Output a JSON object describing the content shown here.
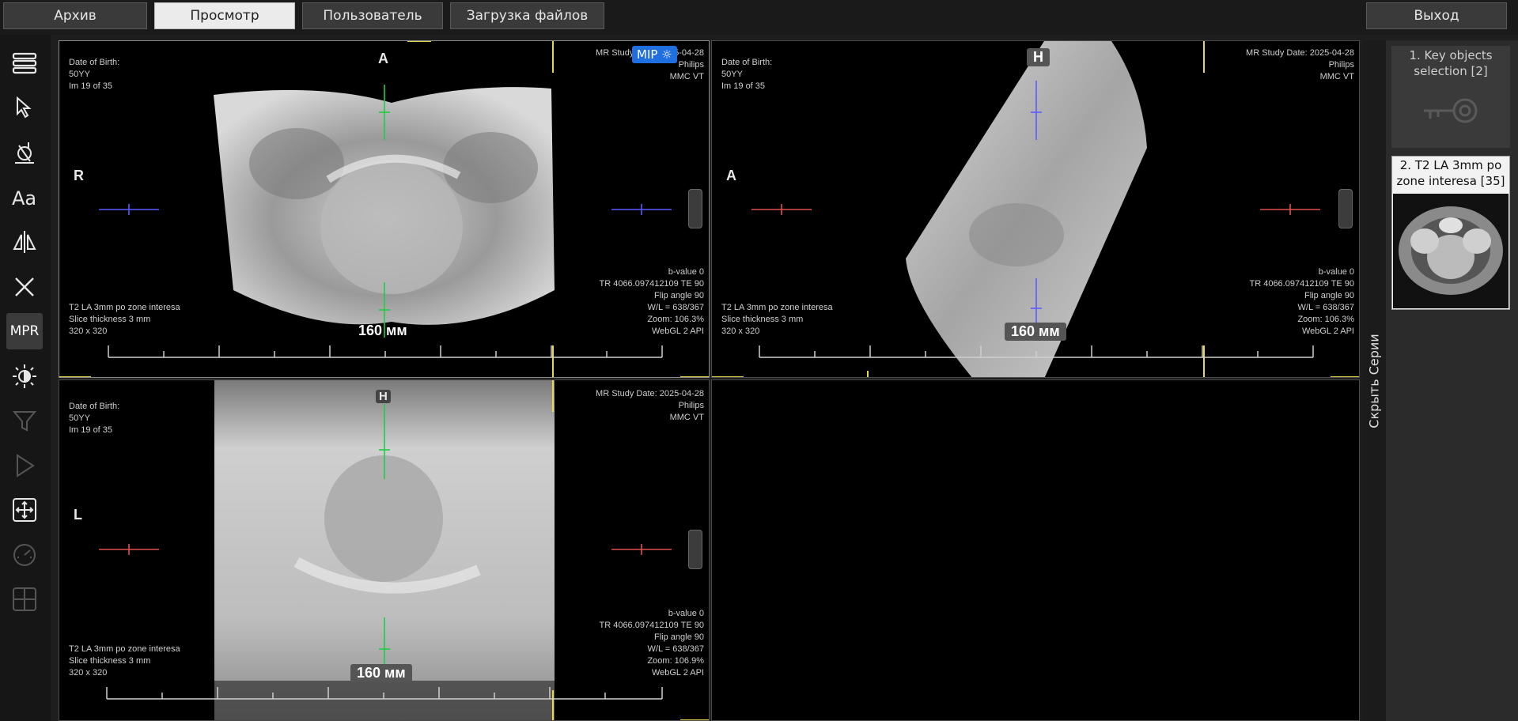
{
  "nav": {
    "archive": "Архив",
    "view": "Просмотр",
    "user": "Пользователь",
    "upload": "Загрузка файлов",
    "exit": "Выход"
  },
  "tools": [
    "layout-icon",
    "pointer-icon",
    "calibrate-icon",
    "annotation-text-icon",
    "flip-icon",
    "close-icon",
    "mpr",
    "window-level-icon",
    "filter-icon",
    "play-icon",
    "fit-screen-icon",
    "gauge-icon",
    "grid-icon"
  ],
  "mpr_label": "MPR",
  "viewports": {
    "axial": {
      "tl": [
        "Date of Birth:",
        "50YY",
        "Im 19 of 35"
      ],
      "tr": [
        "MR Study Date: 2025-04-28",
        "Philips",
        "MMC VT"
      ],
      "bl": [
        "T2 LA 3mm po zone interesa",
        "Slice thickness 3 mm",
        "320 x 320"
      ],
      "br": [
        "b-value 0",
        "TR 4066.097412109 TE 90",
        "Flip angle 90",
        "W/L = 638/367",
        "Zoom: 106.3%",
        "WebGL 2 API"
      ],
      "orient_top": "A",
      "orient_left": "R",
      "scale": "160 мм",
      "mip": "MIP ☼"
    },
    "sagittal": {
      "tl": [
        "Date of Birth:",
        "50YY",
        "Im 19 of 35"
      ],
      "tr": [
        "MR Study Date: 2025-04-28",
        "Philips",
        "MMC VT"
      ],
      "bl": [
        "T2 LA 3mm po zone interesa",
        "Slice thickness 3 mm",
        "320 x 320"
      ],
      "br": [
        "b-value 0",
        "TR 4066.097412109 TE 90",
        "Flip angle 90",
        "W/L = 638/367",
        "Zoom: 106.3%",
        "WebGL 2 API"
      ],
      "orient_top": "H",
      "orient_left": "A",
      "scale": "160 мм"
    },
    "coronal": {
      "tl": [
        "Date of Birth:",
        "50YY",
        "Im 19 of 35"
      ],
      "tr": [
        "MR Study Date: 2025-04-28",
        "Philips",
        "MMC VT"
      ],
      "bl": [
        "T2 LA 3mm po zone interesa",
        "Slice thickness 3 mm",
        "320 x 320"
      ],
      "br": [
        "b-value 0",
        "TR 4066.097412109 TE 90",
        "Flip angle 90",
        "W/L = 638/367",
        "Zoom: 106.9%",
        "WebGL 2 API"
      ],
      "orient_top": "H",
      "orient_left": "L",
      "scale": "160 мм"
    }
  },
  "side_tab": "Скрыть Серии",
  "series": [
    {
      "label": "1. Key objects selection [2]",
      "icon": "key-icon"
    },
    {
      "label": "2. T2 LA 3mm po zone interesa [35]"
    }
  ],
  "colors": {
    "accent": "#1f6fe0",
    "crosshair_blue": "#5b5bff",
    "crosshair_red": "#e05050",
    "crosshair_green": "#22cc44",
    "marker_yellow": "#e6d84a"
  }
}
